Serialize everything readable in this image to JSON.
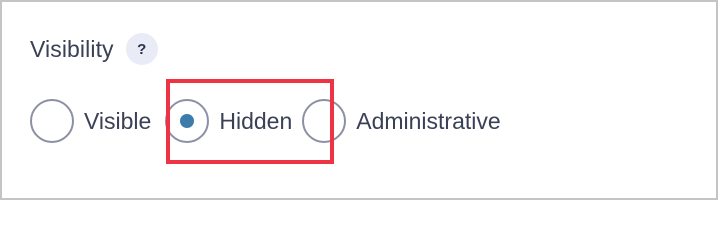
{
  "field": {
    "label": "Visibility",
    "help_glyph": "?"
  },
  "options": [
    {
      "label": "Visible",
      "selected": false
    },
    {
      "label": "Hidden",
      "selected": true
    },
    {
      "label": "Administrative",
      "selected": false
    }
  ],
  "colors": {
    "selected_dot": "#3d7bab",
    "highlight": "#ee3344",
    "border": "#c4c4c4",
    "help_badge_bg": "#e9ebf6"
  },
  "icons": {
    "help": "question-mark-icon"
  }
}
